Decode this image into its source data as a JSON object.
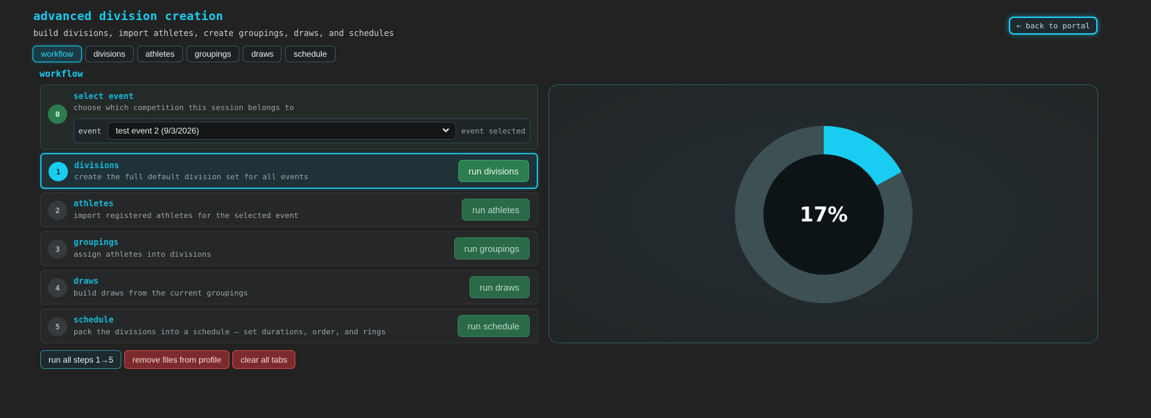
{
  "header": {
    "title": "advanced division creation",
    "subtitle": "build divisions, import athletes, create groupings, draws, and schedules",
    "back_label": "← back to portal"
  },
  "tabs": [
    {
      "label": "workflow",
      "active": true
    },
    {
      "label": "divisions",
      "active": false
    },
    {
      "label": "athletes",
      "active": false
    },
    {
      "label": "groupings",
      "active": false
    },
    {
      "label": "draws",
      "active": false
    },
    {
      "label": "schedule",
      "active": false
    }
  ],
  "section_title": "workflow",
  "steps": [
    {
      "num": "0",
      "title": "select event",
      "desc": "choose which competition this session belongs to"
    },
    {
      "num": "1",
      "title": "divisions",
      "desc": "create the full default division set for all events",
      "button": "run divisions"
    },
    {
      "num": "2",
      "title": "athletes",
      "desc": "import registered athletes for the selected event",
      "button": "run athletes"
    },
    {
      "num": "3",
      "title": "groupings",
      "desc": "assign athletes into divisions",
      "button": "run groupings"
    },
    {
      "num": "4",
      "title": "draws",
      "desc": "build draws from the current groupings",
      "button": "run draws"
    },
    {
      "num": "5",
      "title": "schedule",
      "desc": "pack the divisions into a schedule — set durations, order, and rings",
      "button": "run schedule"
    }
  ],
  "event_select": {
    "label": "event",
    "value": "test event 2 (9/3/2026)",
    "status": "event selected"
  },
  "actions": {
    "run_all": "run all steps 1→5",
    "remove_files": "remove files from profile",
    "clear_tabs": "clear all tabs"
  },
  "progress": {
    "percent": 17,
    "label": "17%",
    "colors": {
      "fill": "#19cdf2",
      "track": "#3d5054",
      "center": "#0d1416"
    }
  }
}
